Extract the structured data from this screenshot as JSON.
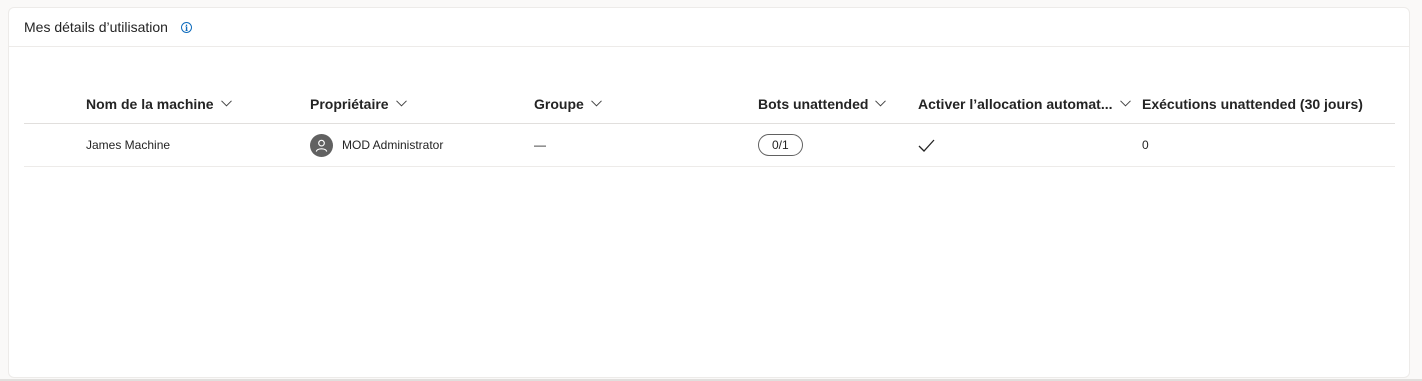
{
  "card": {
    "title": "Mes détails d’utilisation",
    "info_icon": "info-icon"
  },
  "table": {
    "columns": [
      {
        "label": "Nom de la machine",
        "sortable": true
      },
      {
        "label": "Propriétaire",
        "sortable": true
      },
      {
        "label": "Groupe",
        "sortable": true
      },
      {
        "label": "Bots unattended",
        "sortable": true
      },
      {
        "label": "Activer l’allocation automat...",
        "sortable": true
      },
      {
        "label": "Exécutions unattended (30 jours)",
        "sortable": false
      }
    ],
    "rows": [
      {
        "machine": "James Machine",
        "owner": "MOD Administrator",
        "group": "—",
        "bots": "0/1",
        "auto_allocation": "checkmark-icon",
        "runs": "0"
      }
    ]
  },
  "colors": {
    "accent": "#0f6cbd",
    "avatar_bg": "#616161",
    "border": "#edebe9"
  }
}
